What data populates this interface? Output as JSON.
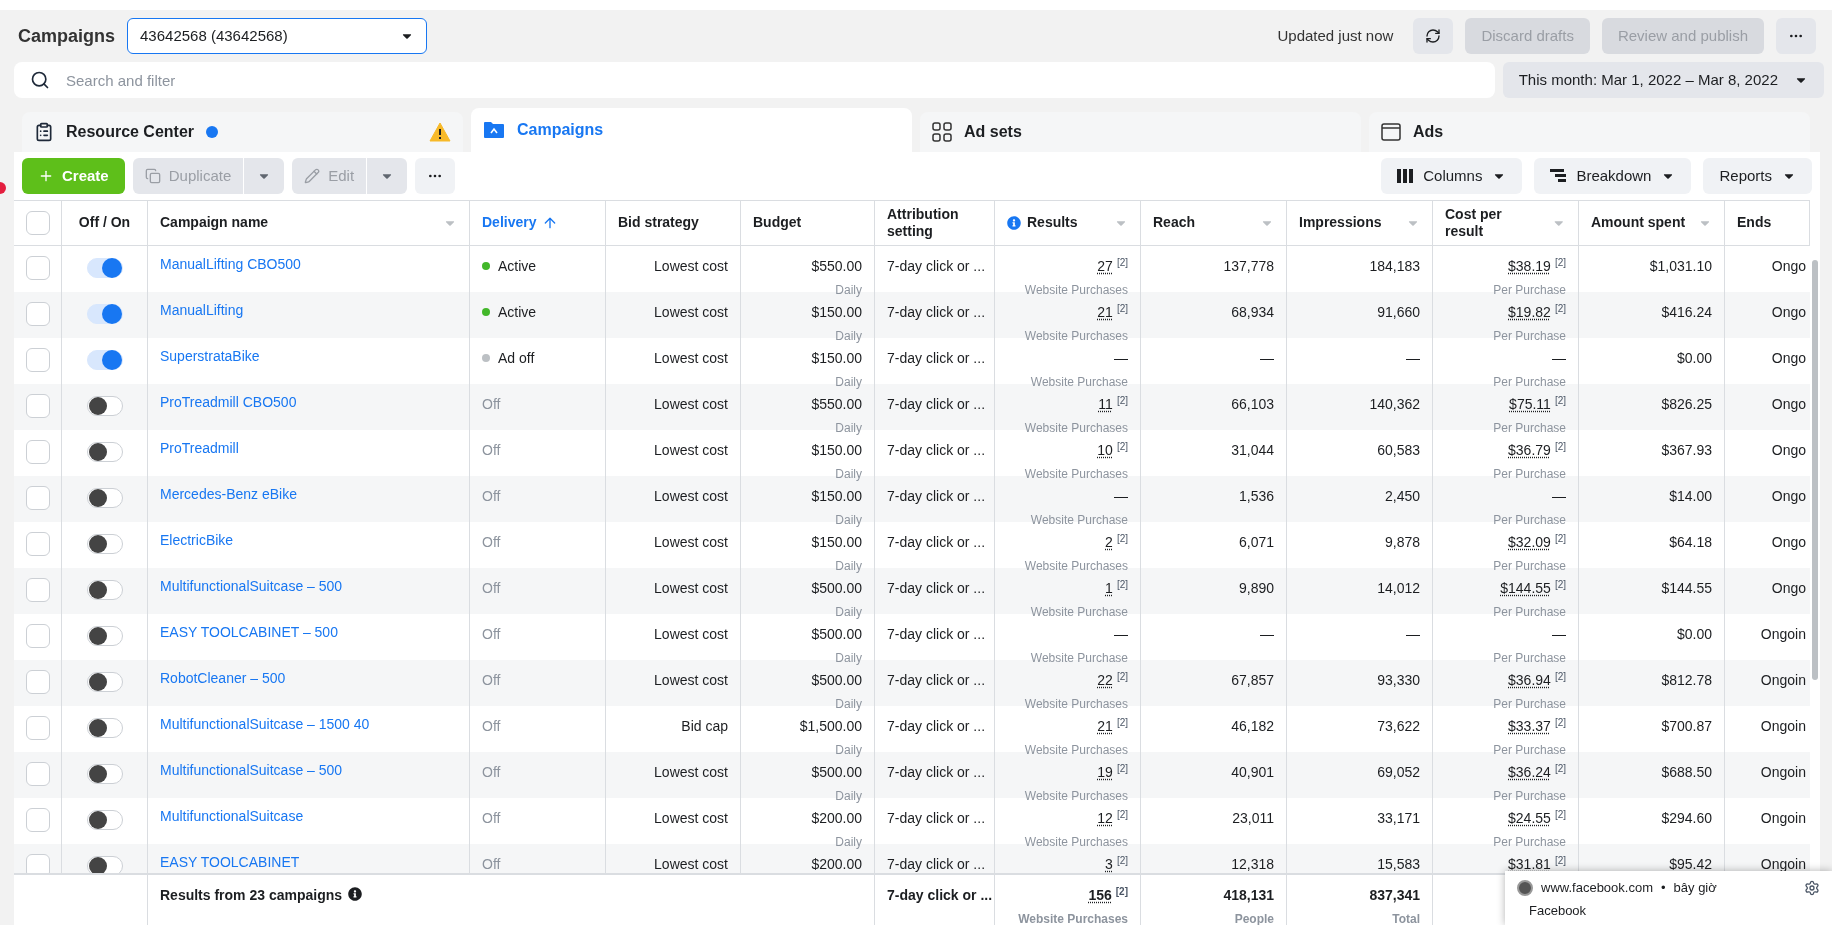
{
  "header": {
    "title": "Campaigns",
    "account": "43642568 (43642568)",
    "updated": "Updated just now",
    "buttons": [
      {
        "label": "Discard drafts",
        "disabled": true
      },
      {
        "label": "Review and publish",
        "disabled": true
      }
    ]
  },
  "search": {
    "placeholder": "Search and filter"
  },
  "date_range": "This month: Mar 1, 2022 – Mar 8, 2022",
  "tabs": [
    {
      "kind": "resource",
      "label": "Resource Center",
      "selected": false
    },
    {
      "kind": "campaigns",
      "label": "Campaigns",
      "selected": true
    },
    {
      "kind": "adsets",
      "label": "Ad sets",
      "selected": false
    },
    {
      "kind": "ads",
      "label": "Ads",
      "selected": false
    }
  ],
  "toolbar": {
    "create": "Create",
    "actions": [
      {
        "label": "Duplicate",
        "kind": "duplicate",
        "disabled": true
      },
      {
        "label": "Edit",
        "kind": "edit",
        "disabled": true
      }
    ],
    "right": [
      {
        "label": "Columns",
        "kind": "columns"
      },
      {
        "label": "Breakdown",
        "kind": "breakdown"
      },
      {
        "label": "Reports",
        "kind": "reports"
      }
    ]
  },
  "table": {
    "all_checked": false,
    "columns": [
      {
        "label": "Off / On",
        "sorted": false,
        "menu": false,
        "info": false
      },
      {
        "label": "Campaign name",
        "sorted": false,
        "menu": true,
        "info": false
      },
      {
        "label": "Delivery",
        "sorted": true,
        "menu": false,
        "info": false
      },
      {
        "label": "Bid strategy",
        "sorted": false,
        "menu": false,
        "info": false
      },
      {
        "label": "Budget",
        "sorted": false,
        "menu": false,
        "info": false
      },
      {
        "label": "Attribution setting",
        "sorted": false,
        "menu": false,
        "info": false
      },
      {
        "label": "Results",
        "sorted": false,
        "menu": true,
        "info": true
      },
      {
        "label": "Reach",
        "sorted": false,
        "menu": true,
        "info": false
      },
      {
        "label": "Impressions",
        "sorted": false,
        "menu": true,
        "info": false
      },
      {
        "label": "Cost per result",
        "sorted": false,
        "menu": true,
        "info": false
      },
      {
        "label": "Amount spent",
        "sorted": false,
        "menu": true,
        "info": false
      },
      {
        "label": "Ends",
        "sorted": false,
        "menu": false,
        "info": false
      }
    ],
    "rows": [
      {
        "checked": false,
        "on": true,
        "name": "ManualLifting CBO500",
        "delivery": {
          "kind": "active",
          "text": "Active"
        },
        "bid": "Lowest cost",
        "budget": "$550.00",
        "budget_note": "Daily",
        "attribution": "7-day click or ...",
        "results": "27",
        "results_ref": "[2]",
        "results_note": "Website Purchases",
        "reach": "137,778",
        "impressions": "184,183",
        "cost": "$38.19",
        "cost_ref": "[2]",
        "cost_note": "Per Purchase",
        "spent": "$1,031.10",
        "ends": "Ongo"
      },
      {
        "checked": false,
        "on": true,
        "name": "ManualLifting",
        "delivery": {
          "kind": "active",
          "text": "Active"
        },
        "bid": "Lowest cost",
        "budget": "$150.00",
        "budget_note": "Daily",
        "attribution": "7-day click or ...",
        "results": "21",
        "results_ref": "[2]",
        "results_note": "Website Purchases",
        "reach": "68,934",
        "impressions": "91,660",
        "cost": "$19.82",
        "cost_ref": "[2]",
        "cost_note": "Per Purchase",
        "spent": "$416.24",
        "ends": "Ongo"
      },
      {
        "checked": false,
        "on": true,
        "name": "SuperstrataBike",
        "delivery": {
          "kind": "ad_off",
          "text": "Ad off"
        },
        "bid": "Lowest cost",
        "budget": "$150.00",
        "budget_note": "Daily",
        "attribution": "7-day click or ...",
        "results": "—",
        "results_note": "Website Purchase",
        "reach": "—",
        "impressions": "—",
        "cost": "—",
        "cost_note": "Per Purchase",
        "spent": "$0.00",
        "ends": "Ongo"
      },
      {
        "checked": false,
        "on": false,
        "name": "ProTreadmill CBO500",
        "delivery": {
          "kind": "off",
          "text": "Off"
        },
        "bid": "Lowest cost",
        "budget": "$550.00",
        "budget_note": "Daily",
        "attribution": "7-day click or ...",
        "results": "11",
        "results_ref": "[2]",
        "results_note": "Website Purchases",
        "reach": "66,103",
        "impressions": "140,362",
        "cost": "$75.11",
        "cost_ref": "[2]",
        "cost_note": "Per Purchase",
        "spent": "$826.25",
        "ends": "Ongo"
      },
      {
        "checked": false,
        "on": false,
        "name": "ProTreadmill",
        "delivery": {
          "kind": "off",
          "text": "Off"
        },
        "bid": "Lowest cost",
        "budget": "$150.00",
        "budget_note": "Daily",
        "attribution": "7-day click or ...",
        "results": "10",
        "results_ref": "[2]",
        "results_note": "Website Purchases",
        "reach": "31,044",
        "impressions": "60,583",
        "cost": "$36.79",
        "cost_ref": "[2]",
        "cost_note": "Per Purchase",
        "spent": "$367.93",
        "ends": "Ongo"
      },
      {
        "checked": false,
        "on": false,
        "name": "Mercedes-Benz eBike",
        "delivery": {
          "kind": "off",
          "text": "Off"
        },
        "bid": "Lowest cost",
        "budget": "$150.00",
        "budget_note": "Daily",
        "attribution": "7-day click or ...",
        "results": "—",
        "results_note": "Website Purchase",
        "reach": "1,536",
        "impressions": "2,450",
        "cost": "—",
        "cost_note": "Per Purchase",
        "spent": "$14.00",
        "ends": "Ongo"
      },
      {
        "checked": false,
        "on": false,
        "name": "ElectricBike",
        "delivery": {
          "kind": "off",
          "text": "Off"
        },
        "bid": "Lowest cost",
        "budget": "$150.00",
        "budget_note": "Daily",
        "attribution": "7-day click or ...",
        "results": "2",
        "results_ref": "[2]",
        "results_note": "Website Purchases",
        "reach": "6,071",
        "impressions": "9,878",
        "cost": "$32.09",
        "cost_ref": "[2]",
        "cost_note": "Per Purchase",
        "spent": "$64.18",
        "ends": "Ongo"
      },
      {
        "checked": false,
        "on": false,
        "name": "MultifunctionalSuitcase – 500",
        "delivery": {
          "kind": "off",
          "text": "Off"
        },
        "bid": "Lowest cost",
        "budget": "$500.00",
        "budget_note": "Daily",
        "attribution": "7-day click or ...",
        "results": "1",
        "results_ref": "[2]",
        "results_note": "Website Purchase",
        "reach": "9,890",
        "impressions": "14,012",
        "cost": "$144.55",
        "cost_ref": "[2]",
        "cost_note": "Per Purchase",
        "spent": "$144.55",
        "ends": "Ongo"
      },
      {
        "checked": false,
        "on": false,
        "name": "EASY TOOLCABINET – 500",
        "delivery": {
          "kind": "off",
          "text": "Off"
        },
        "bid": "Lowest cost",
        "budget": "$500.00",
        "budget_note": "Daily",
        "attribution": "7-day click or ...",
        "results": "—",
        "results_note": "Website Purchase",
        "reach": "—",
        "impressions": "—",
        "cost": "—",
        "cost_note": "Per Purchase",
        "spent": "$0.00",
        "ends": "Ongoin"
      },
      {
        "checked": false,
        "on": false,
        "name": "RobotCleaner – 500",
        "delivery": {
          "kind": "off",
          "text": "Off"
        },
        "bid": "Lowest cost",
        "budget": "$500.00",
        "budget_note": "Daily",
        "attribution": "7-day click or ...",
        "results": "22",
        "results_ref": "[2]",
        "results_note": "Website Purchases",
        "reach": "67,857",
        "impressions": "93,330",
        "cost": "$36.94",
        "cost_ref": "[2]",
        "cost_note": "Per Purchase",
        "spent": "$812.78",
        "ends": "Ongoin"
      },
      {
        "checked": false,
        "on": false,
        "name": "MultifunctionalSuitcase – 1500 40",
        "delivery": {
          "kind": "off",
          "text": "Off"
        },
        "bid": "Bid cap",
        "budget": "$1,500.00",
        "budget_note": "Daily",
        "attribution": "7-day click or ...",
        "results": "21",
        "results_ref": "[2]",
        "results_note": "Website Purchases",
        "reach": "46,182",
        "impressions": "73,622",
        "cost": "$33.37",
        "cost_ref": "[2]",
        "cost_note": "Per Purchase",
        "spent": "$700.87",
        "ends": "Ongoin"
      },
      {
        "checked": false,
        "on": false,
        "name": "MultifunctionalSuitcase – 500",
        "delivery": {
          "kind": "off",
          "text": "Off"
        },
        "bid": "Lowest cost",
        "budget": "$500.00",
        "budget_note": "Daily",
        "attribution": "7-day click or ...",
        "results": "19",
        "results_ref": "[2]",
        "results_note": "Website Purchases",
        "reach": "40,901",
        "impressions": "69,052",
        "cost": "$36.24",
        "cost_ref": "[2]",
        "cost_note": "Per Purchase",
        "spent": "$688.50",
        "ends": "Ongoin"
      },
      {
        "checked": false,
        "on": false,
        "name": "MultifunctionalSuitcase",
        "delivery": {
          "kind": "off",
          "text": "Off"
        },
        "bid": "Lowest cost",
        "budget": "$200.00",
        "budget_note": "Daily",
        "attribution": "7-day click or ...",
        "results": "12",
        "results_ref": "[2]",
        "results_note": "Website Purchases",
        "reach": "23,011",
        "impressions": "33,171",
        "cost": "$24.55",
        "cost_ref": "[2]",
        "cost_note": "Per Purchase",
        "spent": "$294.60",
        "ends": "Ongoin"
      },
      {
        "checked": false,
        "on": false,
        "name": "EASY TOOLCABINET",
        "delivery": {
          "kind": "off",
          "text": "Off"
        },
        "bid": "Lowest cost",
        "budget": "$200.00",
        "attribution": "7-day click or ...",
        "results": "3",
        "results_ref": "[2]",
        "reach": "12,318",
        "impressions": "15,583",
        "cost": "$31.81",
        "cost_ref": "[2]",
        "spent": "$95.42",
        "ends": "Ongoin"
      }
    ],
    "footer": {
      "label": "Results from 23 campaigns",
      "attribution": "7-day click or ...",
      "results": "156",
      "results_ref": "[2]",
      "results_note": "Website Purchases",
      "reach": "418,131",
      "reach_note": "People",
      "impressions": "837,341",
      "impressions_note": "Total"
    }
  },
  "notification": {
    "site": "www.facebook.com",
    "separator": "•",
    "time": "bây giờ",
    "title": "Facebook"
  }
}
